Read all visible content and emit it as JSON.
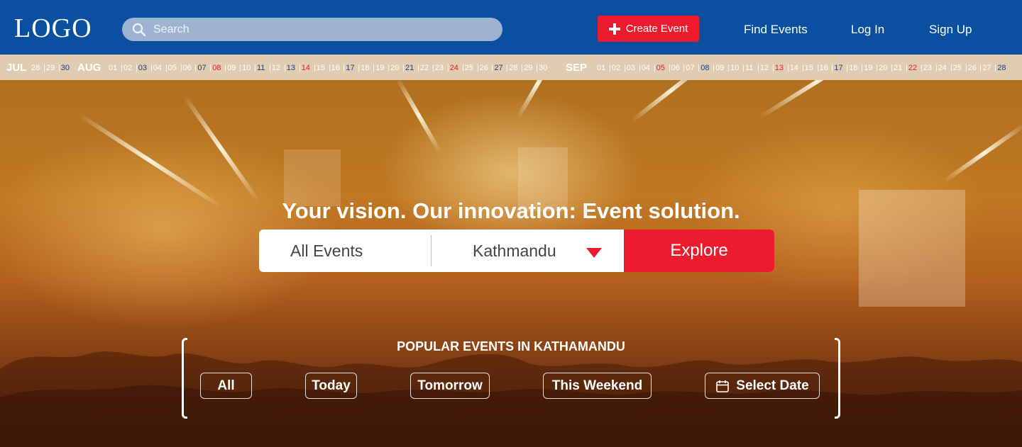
{
  "header": {
    "logo": "LOGO",
    "search_placeholder": "Search",
    "create_event": "Create Event",
    "nav": [
      "Find Events",
      "Log In",
      "Sign Up"
    ]
  },
  "datestrip": {
    "months": [
      {
        "label": "JUL",
        "days": [
          {
            "d": "28",
            "c": "white"
          },
          {
            "d": "29",
            "c": "white"
          },
          {
            "d": "30",
            "c": "blue"
          }
        ]
      },
      {
        "label": "AUG",
        "days": [
          {
            "d": "01",
            "c": "white"
          },
          {
            "d": "02",
            "c": "white"
          },
          {
            "d": "03",
            "c": "blue"
          },
          {
            "d": "04",
            "c": "white"
          },
          {
            "d": "05",
            "c": "white"
          },
          {
            "d": "06",
            "c": "white"
          },
          {
            "d": "07",
            "c": "blue"
          },
          {
            "d": "08",
            "c": "red"
          },
          {
            "d": "09",
            "c": "white"
          },
          {
            "d": "10",
            "c": "white"
          },
          {
            "d": "11",
            "c": "blue"
          },
          {
            "d": "12",
            "c": "white"
          },
          {
            "d": "13",
            "c": "blue"
          },
          {
            "d": "14",
            "c": "red"
          },
          {
            "d": "15",
            "c": "white"
          },
          {
            "d": "16",
            "c": "white"
          },
          {
            "d": "17",
            "c": "blue"
          },
          {
            "d": "18",
            "c": "white"
          },
          {
            "d": "19",
            "c": "white"
          },
          {
            "d": "20",
            "c": "white"
          },
          {
            "d": "21",
            "c": "blue"
          },
          {
            "d": "22",
            "c": "white"
          },
          {
            "d": "23",
            "c": "white"
          },
          {
            "d": "24",
            "c": "red"
          },
          {
            "d": "25",
            "c": "white"
          },
          {
            "d": "26",
            "c": "white"
          },
          {
            "d": "27",
            "c": "blue"
          },
          {
            "d": "28",
            "c": "white"
          },
          {
            "d": "29",
            "c": "white"
          },
          {
            "d": "30",
            "c": "white"
          }
        ]
      },
      {
        "label": "SEP",
        "days": [
          {
            "d": "01",
            "c": "white"
          },
          {
            "d": "02",
            "c": "white"
          },
          {
            "d": "03",
            "c": "white"
          },
          {
            "d": "04",
            "c": "white"
          },
          {
            "d": "05",
            "c": "red"
          },
          {
            "d": "06",
            "c": "white"
          },
          {
            "d": "07",
            "c": "white"
          },
          {
            "d": "08",
            "c": "blue"
          },
          {
            "d": "09",
            "c": "white"
          },
          {
            "d": "10",
            "c": "white"
          },
          {
            "d": "11",
            "c": "white"
          },
          {
            "d": "12",
            "c": "white"
          },
          {
            "d": "13",
            "c": "red"
          },
          {
            "d": "14",
            "c": "white"
          },
          {
            "d": "15",
            "c": "white"
          },
          {
            "d": "16",
            "c": "white"
          },
          {
            "d": "17",
            "c": "blue"
          },
          {
            "d": "18",
            "c": "white"
          },
          {
            "d": "19",
            "c": "white"
          },
          {
            "d": "20",
            "c": "white"
          },
          {
            "d": "21",
            "c": "white"
          },
          {
            "d": "22",
            "c": "red"
          },
          {
            "d": "23",
            "c": "white"
          },
          {
            "d": "24",
            "c": "white"
          },
          {
            "d": "25",
            "c": "white"
          },
          {
            "d": "26",
            "c": "white"
          },
          {
            "d": "27",
            "c": "white"
          },
          {
            "d": "28",
            "c": "blue"
          }
        ]
      }
    ]
  },
  "hero": {
    "headline": "Your vision. Our innovation: Event solution.",
    "event_type": "All Events",
    "location": "Kathmandu",
    "explore": "Explore"
  },
  "popular": {
    "title": "POPULAR EVENTS IN KATHAMANDU",
    "filters": [
      "All",
      "Today",
      "Tomorrow",
      "This Weekend",
      "Select Date"
    ]
  },
  "colors": {
    "header_bg": "#0a4fa0",
    "accent_red": "#ec1c2e",
    "datestrip_bg": "#e0ccb0"
  }
}
